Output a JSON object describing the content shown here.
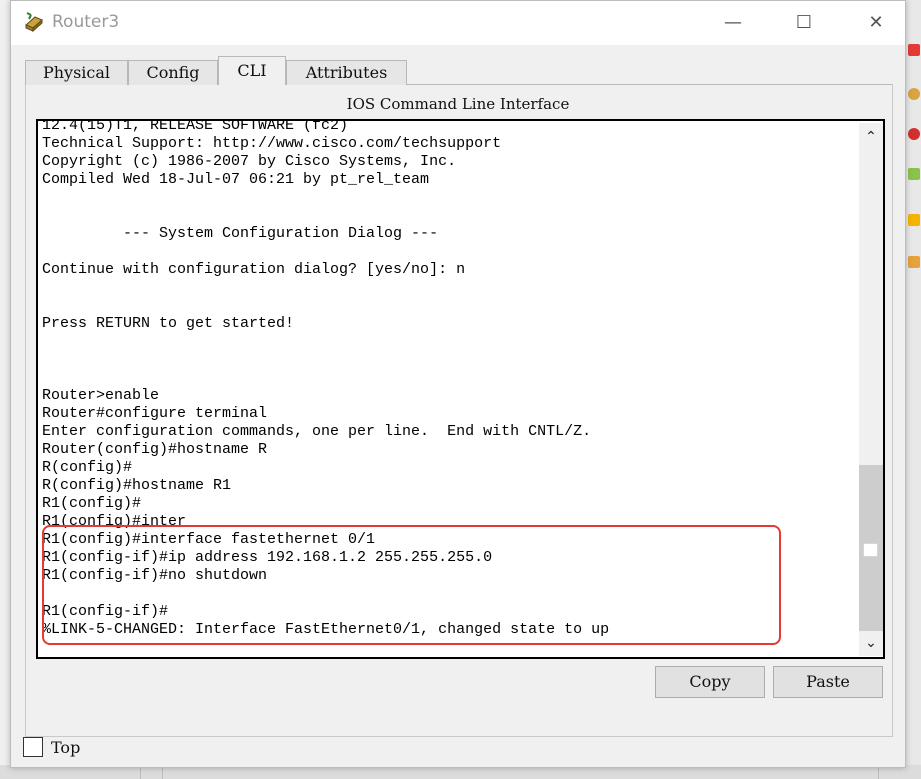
{
  "window": {
    "title": "Router3",
    "app_icon": "router-icon",
    "controls": {
      "minimize": "—",
      "maximize": "☐",
      "close": "✕"
    }
  },
  "tabs": [
    {
      "label": "Physical",
      "active": false
    },
    {
      "label": "Config",
      "active": false
    },
    {
      "label": "CLI",
      "active": true
    },
    {
      "label": "Attributes",
      "active": false
    }
  ],
  "panel_title": "IOS Command Line Interface",
  "terminal": {
    "lines": [
      "12.4(15)T1, RELEASE SOFTWARE (fc2)",
      "Technical Support: http://www.cisco.com/techsupport",
      "Copyright (c) 1986-2007 by Cisco Systems, Inc.",
      "Compiled Wed 18-Jul-07 06:21 by pt_rel_team",
      "",
      "",
      "         --- System Configuration Dialog ---",
      "",
      "Continue with configuration dialog? [yes/no]: n",
      "",
      "",
      "Press RETURN to get started!",
      "",
      "",
      "",
      "Router>enable",
      "Router#configure terminal",
      "Enter configuration commands, one per line.  End with CNTL/Z.",
      "Router(config)#hostname R",
      "R(config)#",
      "R(config)#hostname R1",
      "R1(config)#",
      "R1(config)#inter",
      "R1(config)#interface fastethernet 0/1",
      "R1(config-if)#ip address 192.168.1.2 255.255.255.0",
      "R1(config-if)#no shutdown",
      "",
      "R1(config-if)#",
      "%LINK-5-CHANGED: Interface FastEthernet0/1, changed state to up"
    ],
    "scroll_position": 0.9
  },
  "buttons": {
    "copy": "Copy",
    "paste": "Paste"
  },
  "top_checkbox": {
    "label": "Top",
    "checked": false
  },
  "colors": {
    "highlight": "#e53935",
    "title_text": "#999999"
  }
}
